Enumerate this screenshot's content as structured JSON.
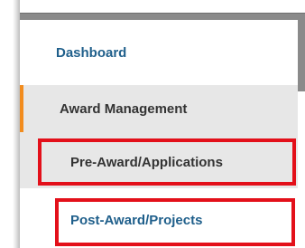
{
  "sidebar": {
    "items": [
      {
        "label": "Dashboard"
      },
      {
        "label": "Award Management"
      },
      {
        "label": "Pre-Award/Applications"
      },
      {
        "label": "Post-Award/Projects"
      }
    ]
  },
  "colors": {
    "link_blue": "#1f5f8b",
    "active_accent": "#f28c1e",
    "highlight_red": "#e3101a",
    "active_bg": "#e7e7e7"
  }
}
